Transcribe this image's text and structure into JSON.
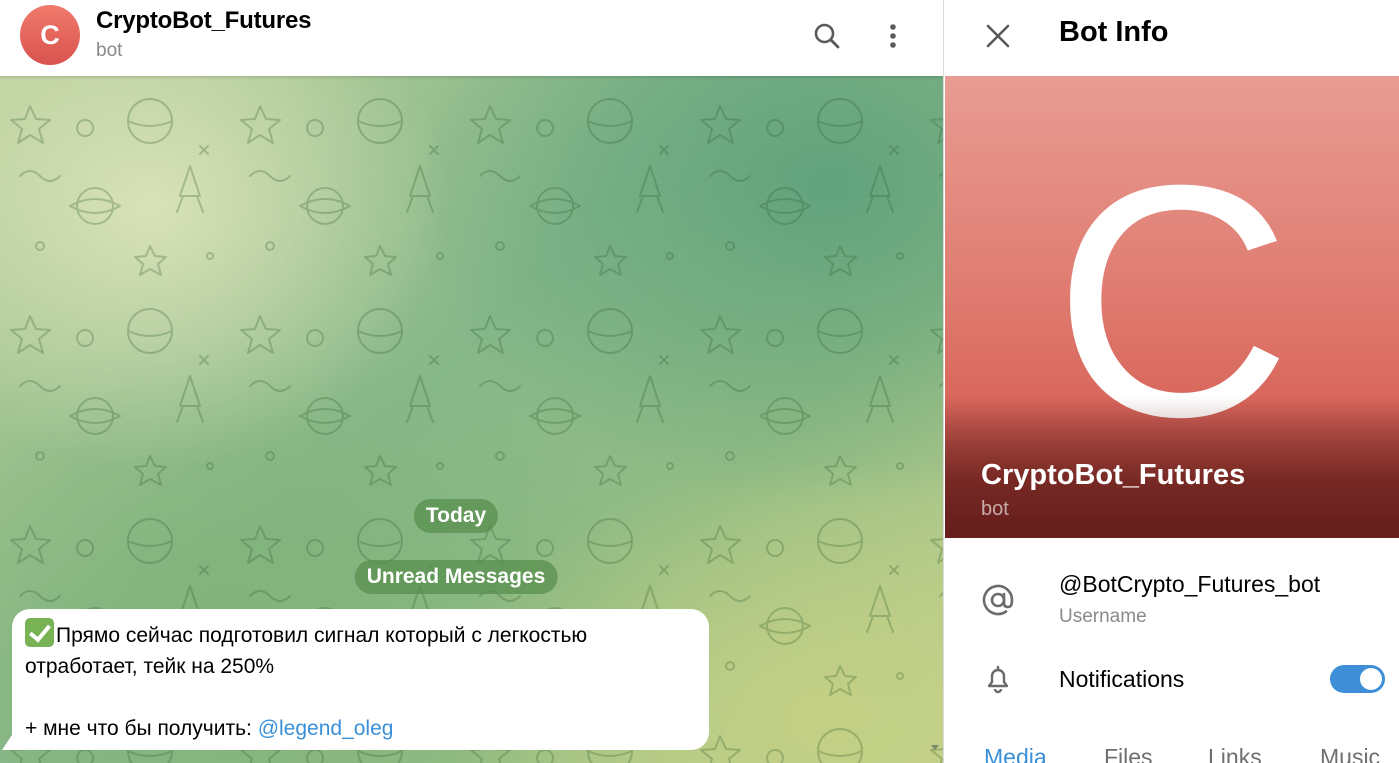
{
  "chat": {
    "title": "CryptoBot_Futures",
    "subtitle": "bot",
    "avatar_letter": "C",
    "actions": {
      "search_icon": "search-icon",
      "more_icon": "more-vertical-icon"
    },
    "date_label": "Today",
    "unread_label": "Unread Messages",
    "message": {
      "emoji": "white-check-mark",
      "line1": "Прямо сейчас подготовил сигнал который с легкостью",
      "line2": "отработает, тейк на 250%",
      "line3_prefix": "+ мне что бы получить: ",
      "mention": "@legend_oleg"
    }
  },
  "info": {
    "title": "Bot Info",
    "close_icon": "close-icon",
    "hero_letter": "C",
    "name": "CryptoBot_Futures",
    "subtitle": "bot",
    "username": {
      "value": "@BotCrypto_Futures_bot",
      "label": "Username",
      "icon": "at-icon"
    },
    "notifications": {
      "label": "Notifications",
      "enabled": true,
      "icon": "bell-icon"
    },
    "tabs": [
      {
        "label": "Media",
        "active": true
      },
      {
        "label": "Files",
        "active": false
      },
      {
        "label": "Links",
        "active": false
      },
      {
        "label": "Music",
        "active": false
      }
    ]
  },
  "colors": {
    "accent": "#3a8fd9",
    "avatar": "#e0645a",
    "pill": "#5a8e4c",
    "toggle": "#3e8fd8"
  }
}
